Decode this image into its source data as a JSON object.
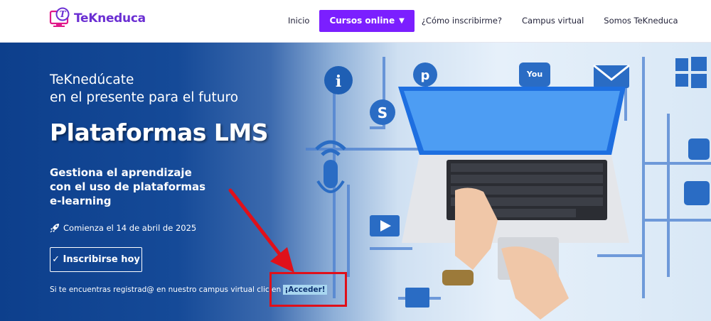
{
  "header": {
    "logo_letter": "T",
    "brand": "TeKneduca",
    "nav": {
      "inicio": "Inicio",
      "cursos": "Cursos online",
      "cursos_caret": "▼",
      "inscribirme": "¿Cómo inscribirme?",
      "campus": "Campus virtual",
      "somos": "Somos TeKneduca"
    }
  },
  "hero": {
    "tagline_line1": "TeKnedúcate",
    "tagline_line2": "en el presente para el futuro",
    "title": "Plataformas LMS",
    "subtitle_line1": "Gestiona el aprendizaje",
    "subtitle_line2": "con el uso de plataformas",
    "subtitle_line3": "e-learning",
    "start_date": "Comienza el 14 de abril de 2025",
    "cta_label": "✓ Inscribirse hoy",
    "access_text": "Si te encuentras registrad@ en nuestro campus virtual clic en",
    "access_link": "¡Acceder!"
  },
  "colors": {
    "brand_purple": "#6b2fd3",
    "button_purple": "#7b1fff",
    "hero_blue": "#0d3f8c",
    "annotation_red": "#e0101a"
  }
}
